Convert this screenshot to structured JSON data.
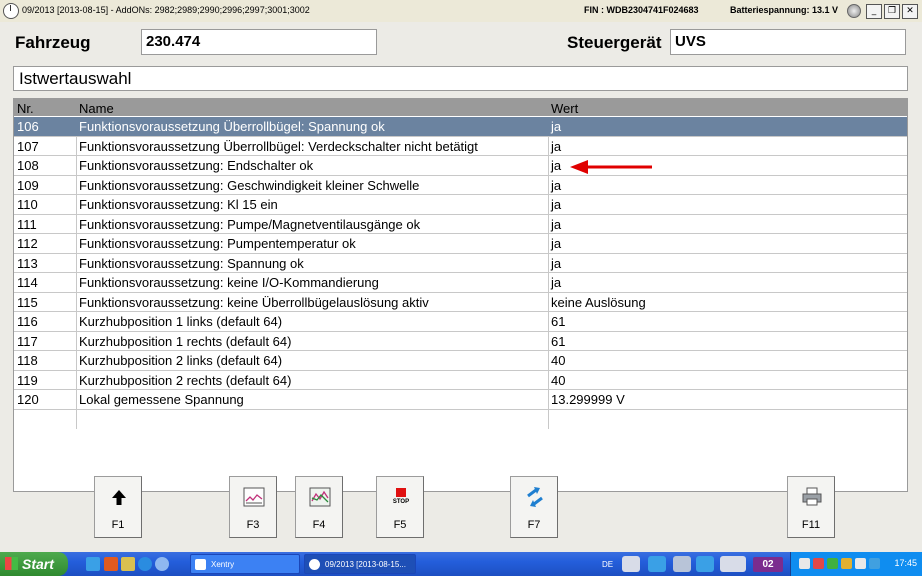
{
  "titlebar": {
    "title": "09/2013 [2013-08-15] - AddONs: 2982;2989;2990;2996;2997;3001;3002",
    "fin": "FIN : WDB2304741F024683",
    "battery": "Batteriespannung: 13.1 V",
    "minimize": "_",
    "restore": "❐",
    "close": "✕"
  },
  "header": {
    "vehicle_label": "Fahrzeug",
    "vehicle_value": "230.474",
    "ecu_label": "Steuergerät",
    "ecu_value": "UVS"
  },
  "section_title": "Istwertauswahl",
  "table": {
    "columns": [
      "Nr.",
      "Name",
      "Wert"
    ],
    "rows": [
      {
        "nr": "106",
        "name": "Funktionsvoraussetzung Überrollbügel: Spannung ok",
        "wert": "ja",
        "selected": true
      },
      {
        "nr": "107",
        "name": "Funktionsvoraussetzung Überrollbügel: Verdeckschalter nicht betätigt",
        "wert": "ja"
      },
      {
        "nr": "108",
        "name": "Funktionsvoraussetzung: Endschalter ok",
        "wert": "ja"
      },
      {
        "nr": "109",
        "name": "Funktionsvoraussetzung: Geschwindigkeit kleiner Schwelle",
        "wert": "ja"
      },
      {
        "nr": "110",
        "name": "Funktionsvoraussetzung: Kl 15 ein",
        "wert": "ja"
      },
      {
        "nr": "111",
        "name": "Funktionsvoraussetzung: Pumpe/Magnetventilausgänge ok",
        "wert": "ja"
      },
      {
        "nr": "112",
        "name": "Funktionsvoraussetzung: Pumpentemperatur ok",
        "wert": "ja"
      },
      {
        "nr": "113",
        "name": "Funktionsvoraussetzung: Spannung ok",
        "wert": "ja"
      },
      {
        "nr": "114",
        "name": "Funktionsvoraussetzung: keine I/O-Kommandierung",
        "wert": "ja"
      },
      {
        "nr": "115",
        "name": "Funktionsvoraussetzung: keine Überrollbügelauslösung aktiv",
        "wert": "keine Auslösung"
      },
      {
        "nr": "116",
        "name": "Kurzhubposition 1 links (default 64)",
        "wert": "61"
      },
      {
        "nr": "117",
        "name": "Kurzhubposition 1 rechts (default 64)",
        "wert": "61"
      },
      {
        "nr": "118",
        "name": "Kurzhubposition 2 links (default 64)",
        "wert": "40"
      },
      {
        "nr": "119",
        "name": "Kurzhubposition 2 rechts (default 64)",
        "wert": "40"
      },
      {
        "nr": "120",
        "name": "Lokal gemessene Spannung",
        "wert": "13.299999 V"
      }
    ]
  },
  "annotation": {
    "color": "#e00000"
  },
  "fkeys": [
    {
      "label": "F1",
      "icon": "arrow-up-icon"
    },
    {
      "label": "F3",
      "icon": "graph-icon"
    },
    {
      "label": "F4",
      "icon": "multi-graph-icon"
    },
    {
      "label": "F5",
      "icon": "stop-icon",
      "icon_text": "STOP"
    },
    {
      "label": "F7",
      "icon": "swap-arrows-icon"
    },
    {
      "label": "F11",
      "icon": "printer-icon"
    }
  ],
  "taskbar": {
    "start": "Start",
    "tasks": [
      "Xentry",
      "09/2013 [2013-08-15..."
    ],
    "lang": "DE",
    "badge": "02",
    "clock": "17:45"
  },
  "colors": {
    "selected_row": "#6b83a0",
    "header_row": "#9a9a9a",
    "taskbar": "#245edb"
  }
}
